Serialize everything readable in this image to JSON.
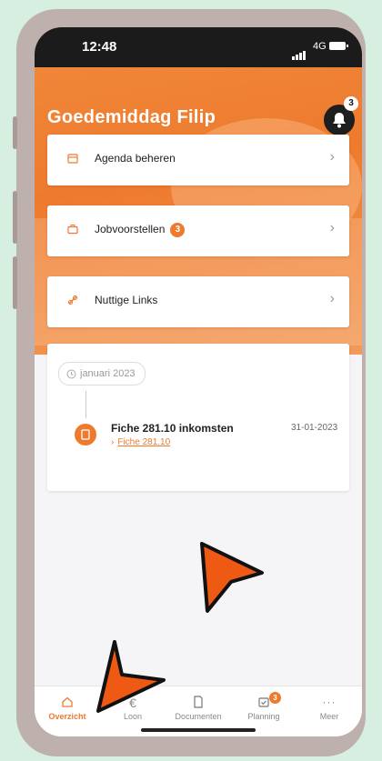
{
  "status_bar": {
    "time": "12:48",
    "network": "4G"
  },
  "header": {
    "greeting": "Goedemiddag Filip",
    "notification_count": "3"
  },
  "menu": [
    {
      "label": "Agenda beheren",
      "icon": "calendar-icon",
      "badge": ""
    },
    {
      "label": "Jobvoorstellen",
      "icon": "briefcase-icon",
      "badge": "3"
    },
    {
      "label": "Nuttige Links",
      "icon": "link-icon",
      "badge": ""
    }
  ],
  "timeline": {
    "month": "januari 2023",
    "entry": {
      "title": "Fiche 281.10 inkomsten",
      "link": "Fiche 281.10",
      "date": "31-01-2023"
    }
  },
  "tabbar": [
    {
      "label": "Overzicht",
      "icon": "home-icon",
      "active": true
    },
    {
      "label": "Loon",
      "icon": "euro-icon"
    },
    {
      "label": "Documenten",
      "icon": "document-icon"
    },
    {
      "label": "Planning",
      "icon": "planning-icon",
      "badge": "3"
    },
    {
      "label": "Meer",
      "icon": "more-icon"
    }
  ],
  "colors": {
    "accent": "#ee7a2e",
    "background": "#d7efe1",
    "frame": "#bdb0ad"
  }
}
